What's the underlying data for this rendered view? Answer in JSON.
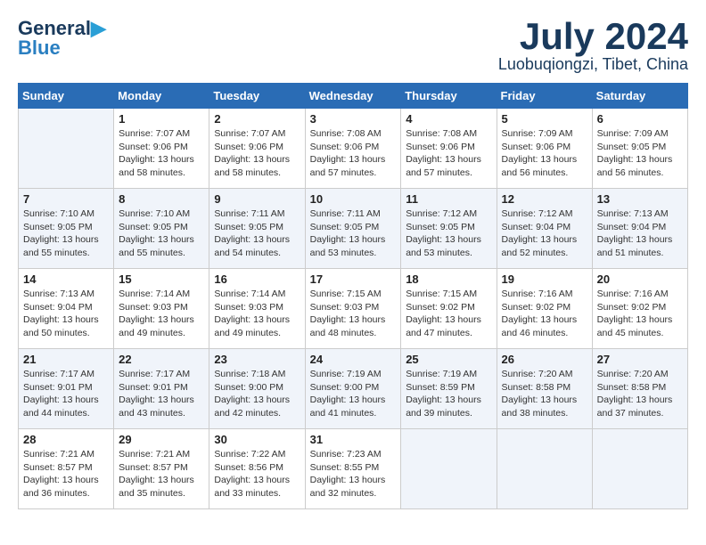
{
  "header": {
    "logo_line1": "General",
    "logo_line2": "Blue",
    "month": "July 2024",
    "location": "Luobuqiongzi, Tibet, China"
  },
  "columns": [
    "Sunday",
    "Monday",
    "Tuesday",
    "Wednesday",
    "Thursday",
    "Friday",
    "Saturday"
  ],
  "weeks": [
    [
      {
        "day": "",
        "sunrise": "",
        "sunset": "",
        "daylight": ""
      },
      {
        "day": "1",
        "sunrise": "Sunrise: 7:07 AM",
        "sunset": "Sunset: 9:06 PM",
        "daylight": "Daylight: 13 hours and 58 minutes."
      },
      {
        "day": "2",
        "sunrise": "Sunrise: 7:07 AM",
        "sunset": "Sunset: 9:06 PM",
        "daylight": "Daylight: 13 hours and 58 minutes."
      },
      {
        "day": "3",
        "sunrise": "Sunrise: 7:08 AM",
        "sunset": "Sunset: 9:06 PM",
        "daylight": "Daylight: 13 hours and 57 minutes."
      },
      {
        "day": "4",
        "sunrise": "Sunrise: 7:08 AM",
        "sunset": "Sunset: 9:06 PM",
        "daylight": "Daylight: 13 hours and 57 minutes."
      },
      {
        "day": "5",
        "sunrise": "Sunrise: 7:09 AM",
        "sunset": "Sunset: 9:06 PM",
        "daylight": "Daylight: 13 hours and 56 minutes."
      },
      {
        "day": "6",
        "sunrise": "Sunrise: 7:09 AM",
        "sunset": "Sunset: 9:05 PM",
        "daylight": "Daylight: 13 hours and 56 minutes."
      }
    ],
    [
      {
        "day": "7",
        "sunrise": "Sunrise: 7:10 AM",
        "sunset": "Sunset: 9:05 PM",
        "daylight": "Daylight: 13 hours and 55 minutes."
      },
      {
        "day": "8",
        "sunrise": "Sunrise: 7:10 AM",
        "sunset": "Sunset: 9:05 PM",
        "daylight": "Daylight: 13 hours and 55 minutes."
      },
      {
        "day": "9",
        "sunrise": "Sunrise: 7:11 AM",
        "sunset": "Sunset: 9:05 PM",
        "daylight": "Daylight: 13 hours and 54 minutes."
      },
      {
        "day": "10",
        "sunrise": "Sunrise: 7:11 AM",
        "sunset": "Sunset: 9:05 PM",
        "daylight": "Daylight: 13 hours and 53 minutes."
      },
      {
        "day": "11",
        "sunrise": "Sunrise: 7:12 AM",
        "sunset": "Sunset: 9:05 PM",
        "daylight": "Daylight: 13 hours and 53 minutes."
      },
      {
        "day": "12",
        "sunrise": "Sunrise: 7:12 AM",
        "sunset": "Sunset: 9:04 PM",
        "daylight": "Daylight: 13 hours and 52 minutes."
      },
      {
        "day": "13",
        "sunrise": "Sunrise: 7:13 AM",
        "sunset": "Sunset: 9:04 PM",
        "daylight": "Daylight: 13 hours and 51 minutes."
      }
    ],
    [
      {
        "day": "14",
        "sunrise": "Sunrise: 7:13 AM",
        "sunset": "Sunset: 9:04 PM",
        "daylight": "Daylight: 13 hours and 50 minutes."
      },
      {
        "day": "15",
        "sunrise": "Sunrise: 7:14 AM",
        "sunset": "Sunset: 9:03 PM",
        "daylight": "Daylight: 13 hours and 49 minutes."
      },
      {
        "day": "16",
        "sunrise": "Sunrise: 7:14 AM",
        "sunset": "Sunset: 9:03 PM",
        "daylight": "Daylight: 13 hours and 49 minutes."
      },
      {
        "day": "17",
        "sunrise": "Sunrise: 7:15 AM",
        "sunset": "Sunset: 9:03 PM",
        "daylight": "Daylight: 13 hours and 48 minutes."
      },
      {
        "day": "18",
        "sunrise": "Sunrise: 7:15 AM",
        "sunset": "Sunset: 9:02 PM",
        "daylight": "Daylight: 13 hours and 47 minutes."
      },
      {
        "day": "19",
        "sunrise": "Sunrise: 7:16 AM",
        "sunset": "Sunset: 9:02 PM",
        "daylight": "Daylight: 13 hours and 46 minutes."
      },
      {
        "day": "20",
        "sunrise": "Sunrise: 7:16 AM",
        "sunset": "Sunset: 9:02 PM",
        "daylight": "Daylight: 13 hours and 45 minutes."
      }
    ],
    [
      {
        "day": "21",
        "sunrise": "Sunrise: 7:17 AM",
        "sunset": "Sunset: 9:01 PM",
        "daylight": "Daylight: 13 hours and 44 minutes."
      },
      {
        "day": "22",
        "sunrise": "Sunrise: 7:17 AM",
        "sunset": "Sunset: 9:01 PM",
        "daylight": "Daylight: 13 hours and 43 minutes."
      },
      {
        "day": "23",
        "sunrise": "Sunrise: 7:18 AM",
        "sunset": "Sunset: 9:00 PM",
        "daylight": "Daylight: 13 hours and 42 minutes."
      },
      {
        "day": "24",
        "sunrise": "Sunrise: 7:19 AM",
        "sunset": "Sunset: 9:00 PM",
        "daylight": "Daylight: 13 hours and 41 minutes."
      },
      {
        "day": "25",
        "sunrise": "Sunrise: 7:19 AM",
        "sunset": "Sunset: 8:59 PM",
        "daylight": "Daylight: 13 hours and 39 minutes."
      },
      {
        "day": "26",
        "sunrise": "Sunrise: 7:20 AM",
        "sunset": "Sunset: 8:58 PM",
        "daylight": "Daylight: 13 hours and 38 minutes."
      },
      {
        "day": "27",
        "sunrise": "Sunrise: 7:20 AM",
        "sunset": "Sunset: 8:58 PM",
        "daylight": "Daylight: 13 hours and 37 minutes."
      }
    ],
    [
      {
        "day": "28",
        "sunrise": "Sunrise: 7:21 AM",
        "sunset": "Sunset: 8:57 PM",
        "daylight": "Daylight: 13 hours and 36 minutes."
      },
      {
        "day": "29",
        "sunrise": "Sunrise: 7:21 AM",
        "sunset": "Sunset: 8:57 PM",
        "daylight": "Daylight: 13 hours and 35 minutes."
      },
      {
        "day": "30",
        "sunrise": "Sunrise: 7:22 AM",
        "sunset": "Sunset: 8:56 PM",
        "daylight": "Daylight: 13 hours and 33 minutes."
      },
      {
        "day": "31",
        "sunrise": "Sunrise: 7:23 AM",
        "sunset": "Sunset: 8:55 PM",
        "daylight": "Daylight: 13 hours and 32 minutes."
      },
      {
        "day": "",
        "sunrise": "",
        "sunset": "",
        "daylight": ""
      },
      {
        "day": "",
        "sunrise": "",
        "sunset": "",
        "daylight": ""
      },
      {
        "day": "",
        "sunrise": "",
        "sunset": "",
        "daylight": ""
      }
    ]
  ]
}
